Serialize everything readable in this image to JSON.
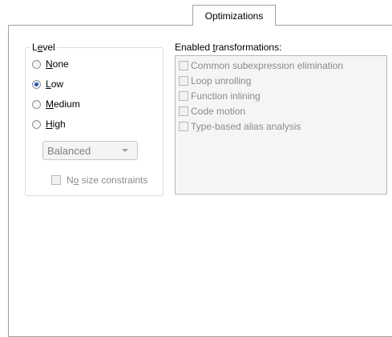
{
  "tabs": [
    {
      "label": "Optimizations",
      "active": true
    }
  ],
  "level_group": {
    "label_pre": "L",
    "label_u": "e",
    "label_post": "vel",
    "options": [
      {
        "u": "N",
        "rest": "one",
        "selected": false
      },
      {
        "u": "L",
        "rest": "ow",
        "selected": true
      },
      {
        "u": "M",
        "rest": "edium",
        "selected": false
      },
      {
        "u": "H",
        "rest": "igh",
        "selected": false
      }
    ],
    "profile_select": {
      "value": "Balanced",
      "enabled": false
    },
    "size_constraints": {
      "pre": "N",
      "u": "o",
      "post": " size constraints",
      "checked": false,
      "enabled": false
    }
  },
  "transformations": {
    "label_pre": "Enabled ",
    "label_u": "t",
    "label_post": "ransformations:",
    "items": [
      {
        "label": "Common subexpression elimination",
        "checked": false
      },
      {
        "label": "Loop unrolling",
        "checked": false
      },
      {
        "label": "Function inlining",
        "checked": false
      },
      {
        "label": "Code motion",
        "checked": false
      },
      {
        "label": "Type-based alias analysis",
        "checked": false
      }
    ],
    "enabled": false
  },
  "colors": {
    "accent": "#1f57c8",
    "disabled_text": "#8a8a8a",
    "border": "#a0a0a0"
  }
}
